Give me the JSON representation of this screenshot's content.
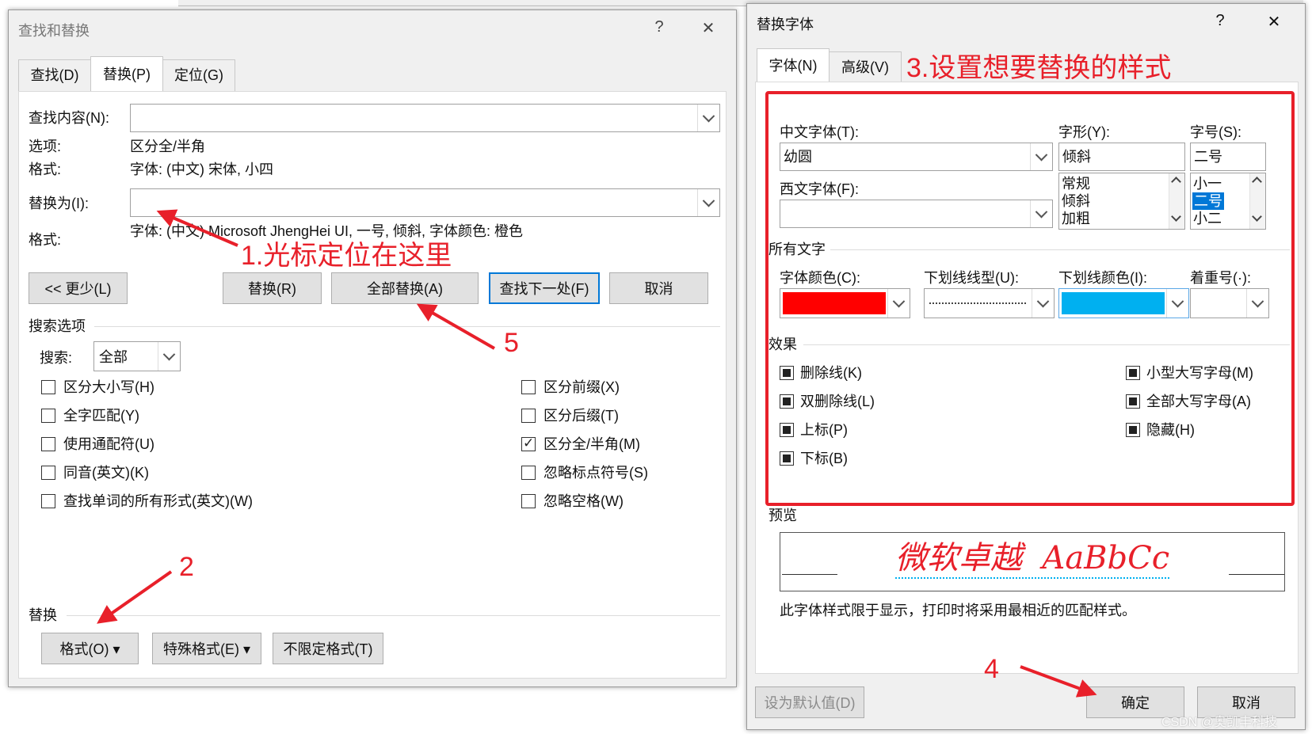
{
  "find_replace": {
    "title": "查找和替换",
    "help": "?",
    "close": "✕",
    "tabs": [
      {
        "label": "查找(D)"
      },
      {
        "label": "替换(P)"
      },
      {
        "label": "定位(G)"
      }
    ],
    "find_label": "查找内容(N):",
    "find_value": "",
    "options_label": "选项:",
    "options_value": "区分全/半角",
    "format_label": "格式:",
    "format_value": "字体: (中文) 宋体, 小四",
    "replace_label": "替换为(I):",
    "replace_value": "",
    "replace_format_label": "格式:",
    "replace_format_value": "字体: (中文) Microsoft JhengHei UI, 一号, 倾斜, 字体颜色: 橙色",
    "buttons": {
      "less": "<< 更少(L)",
      "replace": "替换(R)",
      "replace_all": "全部替换(A)",
      "find_next": "查找下一处(F)",
      "cancel": "取消"
    },
    "search_options_title": "搜索选项",
    "search_label": "搜索:",
    "search_value": "全部",
    "options_left": [
      {
        "label": "区分大小写(H)",
        "checked": false
      },
      {
        "label": "全字匹配(Y)",
        "checked": false
      },
      {
        "label": "使用通配符(U)",
        "checked": false
      },
      {
        "label": "同音(英文)(K)",
        "checked": false
      },
      {
        "label": "查找单词的所有形式(英文)(W)",
        "checked": false
      }
    ],
    "options_right": [
      {
        "label": "区分前缀(X)",
        "checked": false
      },
      {
        "label": "区分后缀(T)",
        "checked": false
      },
      {
        "label": "区分全/半角(M)",
        "checked": true
      },
      {
        "label": "忽略标点符号(S)",
        "checked": false
      },
      {
        "label": "忽略空格(W)",
        "checked": false
      }
    ],
    "replace_section_title": "替换",
    "bottom_buttons": {
      "format": "格式(O) ▾",
      "special": "特殊格式(E) ▾",
      "no_format": "不限定格式(T)"
    }
  },
  "replace_font": {
    "title": "替换字体",
    "help": "?",
    "close": "✕",
    "tabs": [
      {
        "label": "字体(N)"
      },
      {
        "label": "高级(V)"
      }
    ],
    "cn_font_label": "中文字体(T):",
    "cn_font_value": "幼圆",
    "west_font_label": "西文字体(F):",
    "west_font_value": "",
    "style_label": "字形(Y):",
    "style_value": "倾斜",
    "style_items": [
      "常规",
      "倾斜",
      "加粗"
    ],
    "size_label": "字号(S):",
    "size_value": "二号",
    "size_items": [
      "小一",
      "二号",
      "小二"
    ],
    "all_text_title": "所有文字",
    "font_color_label": "字体颜色(C):",
    "underline_type_label": "下划线线型(U):",
    "underline_color_label": "下划线颜色(I):",
    "emphasis_label": "着重号(·):",
    "font_color": "#ff0000",
    "underline_color": "#00b0f0",
    "effects_title": "效果",
    "effects_left": [
      {
        "label": "删除线(K)"
      },
      {
        "label": "双删除线(L)"
      },
      {
        "label": "上标(P)"
      },
      {
        "label": "下标(B)"
      }
    ],
    "effects_right": [
      {
        "label": "小型大写字母(M)"
      },
      {
        "label": "全部大写字母(A)"
      },
      {
        "label": "隐藏(H)"
      }
    ],
    "preview_title": "预览",
    "preview_text": "微软卓越  AaBbCc",
    "preview_note": "此字体样式限于显示，打印时将采用最相近的匹配样式。",
    "set_default": "设为默认值(D)",
    "ok": "确定",
    "cancel": "取消"
  },
  "annotations": {
    "note1": "1.光标定位在这里",
    "note2": "2",
    "note3": "3.设置想要替换的样式",
    "note4": "4",
    "note5": "5",
    "accent": "#e8202a"
  },
  "watermark": "CSDN @奥凯丰科技"
}
